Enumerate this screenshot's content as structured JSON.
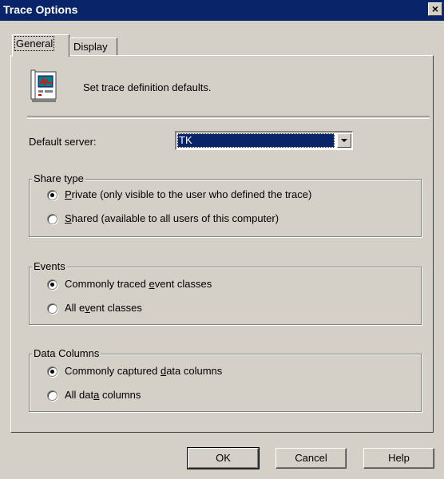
{
  "window": {
    "title": "Trace Options",
    "close_glyph": "×"
  },
  "tabs": [
    {
      "label": "General",
      "active": true
    },
    {
      "label": "Display",
      "active": false
    }
  ],
  "header": {
    "icon": "trace-definition-icon",
    "text": "Set trace definition defaults."
  },
  "default_server": {
    "label": "Default server:",
    "value": "TK"
  },
  "share_type": {
    "legend": "Share type",
    "options": [
      {
        "pre": "",
        "accel": "P",
        "post": "rivate (only visible to the user who defined the trace)",
        "selected": true
      },
      {
        "pre": "",
        "accel": "S",
        "post": "hared (available to all users of this computer)",
        "selected": false
      }
    ]
  },
  "events": {
    "legend": "Events",
    "options": [
      {
        "pre": "Commonly traced ",
        "accel": "e",
        "post": "vent classes",
        "selected": true
      },
      {
        "pre": "All e",
        "accel": "v",
        "post": "ent classes",
        "selected": false
      }
    ]
  },
  "data_columns": {
    "legend": "Data Columns",
    "options": [
      {
        "pre": "Commonly captured ",
        "accel": "d",
        "post": "ata columns",
        "selected": true
      },
      {
        "pre": "All dat",
        "accel": "a",
        "post": " columns",
        "selected": false
      }
    ]
  },
  "buttons": {
    "ok": "OK",
    "cancel": "Cancel",
    "help": "Help"
  }
}
